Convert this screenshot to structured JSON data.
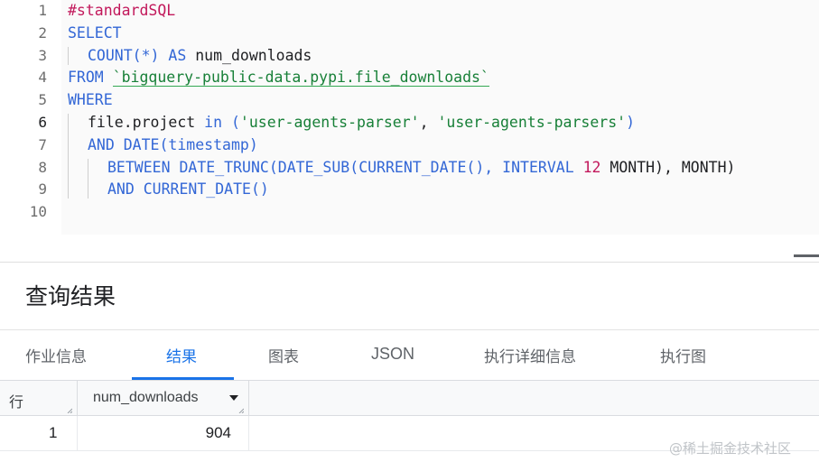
{
  "editor": {
    "line_numbers": [
      "1",
      "2",
      "3",
      "4",
      "5",
      "6",
      "7",
      "8",
      "9",
      "10"
    ],
    "active_line": "6",
    "code": {
      "l1": "#standardSQL",
      "l2_kw": "SELECT",
      "l3_kw1": "COUNT",
      "l3_p": "(*) ",
      "l3_kw2": "AS",
      "l3_id": " num_downloads",
      "l4_kw": "FROM",
      "l4_sp": " ",
      "l4_tbl": "`bigquery-public-data.pypi.file_downloads`",
      "l5_kw": "WHERE",
      "l6_a": "file.project ",
      "l6_kw": "in",
      "l6_b": " (",
      "l6_s1": "'user-agents-parser'",
      "l6_c": ", ",
      "l6_s2": "'user-agents-parsers'",
      "l6_d": ")",
      "l7_kw1": "AND",
      "l7_sp": " ",
      "l7_kw2": "DATE",
      "l7_id": "(timestamp)",
      "l8_kw1": "BETWEEN",
      "l8_sp1": " ",
      "l8_kw2": "DATE_TRUNC",
      "l8_p1": "(",
      "l8_kw3": "DATE_SUB",
      "l8_p2": "(",
      "l8_kw4": "CURRENT_DATE",
      "l8_p3": "(), ",
      "l8_kw5": "INTERVAL",
      "l8_sp2": " ",
      "l8_num": "12",
      "l8_rest": " MONTH), MONTH)",
      "l9_kw1": "AND",
      "l9_sp": " ",
      "l9_kw2": "CURRENT_DATE",
      "l9_p": "()"
    }
  },
  "results": {
    "title": "查询结果",
    "tabs": [
      "作业信息",
      "结果",
      "图表",
      "JSON",
      "执行详细信息",
      "执行图"
    ],
    "active_tab": "结果",
    "columns": [
      "行",
      "num_downloads"
    ],
    "rows": [
      [
        "1",
        "904"
      ]
    ]
  },
  "watermark": "@稀土掘金技术社区",
  "colors": {
    "keyword": "#3367d6",
    "comment": "#c2185b",
    "string": "#188038",
    "accent": "#1a73e8"
  }
}
